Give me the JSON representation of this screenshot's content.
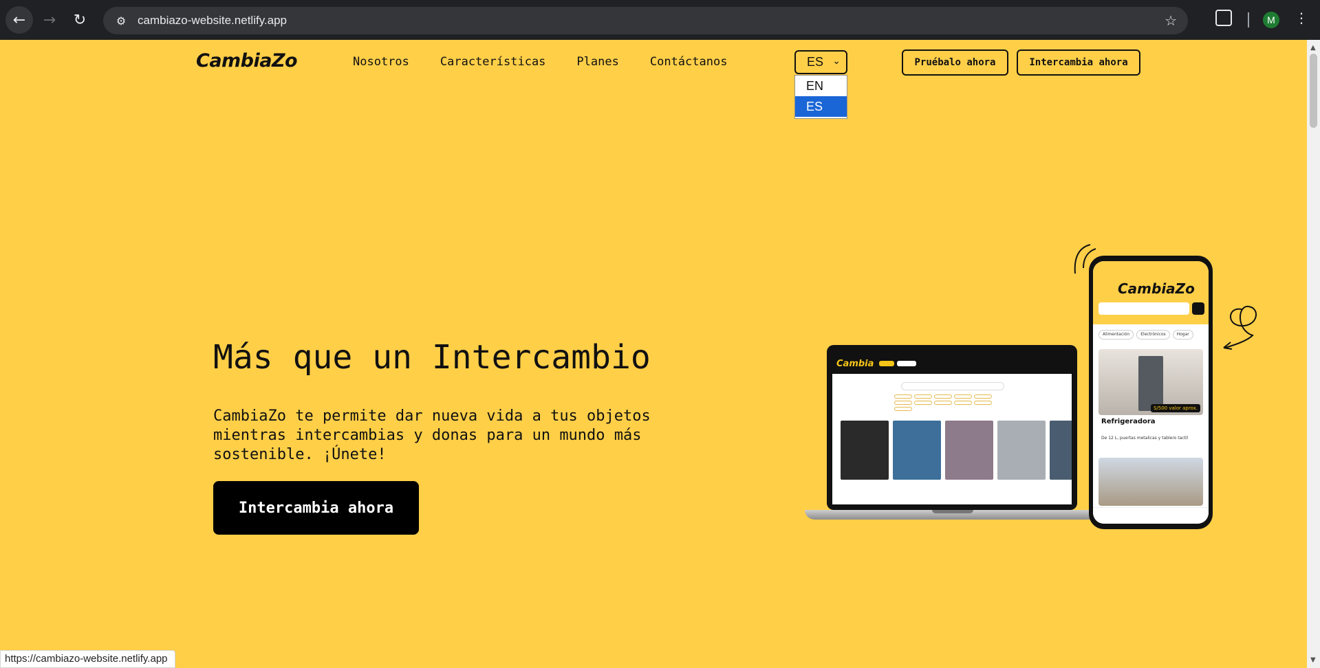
{
  "browser": {
    "url": "cambiazo-website.netlify.app",
    "profile_initial": "M",
    "status_url": "https://cambiazo-website.netlify.app"
  },
  "site": {
    "logo_text": "CambiaZo",
    "nav": [
      "Nosotros",
      "Características",
      "Planes",
      "Contáctanos"
    ],
    "language": {
      "selected": "ES",
      "options": [
        "EN",
        "ES"
      ]
    },
    "buttons": {
      "try_now": "Pruébalo ahora",
      "swap_now": "Intercambia ahora"
    }
  },
  "hero": {
    "title": "Más que un Intercambio",
    "description": "CambiaZo te permite dar nueva vida a tus objetos mientras intercambias y donas para un mundo más sostenible. ¡Únete!",
    "cta": "Intercambia ahora"
  },
  "mockups": {
    "laptop_logo": "Cambia",
    "phone_logo": "CambiaZo",
    "phone_chips": [
      "Alimentación",
      "Electrónicos",
      "Hogar"
    ],
    "phone_price_badge": "S/500 valor aprox.",
    "phone_item_title": "Refrigeradora",
    "phone_item_desc": "De 12 L, puertas metalicas y tablero tactil",
    "laptop_card_colors": [
      "#2a2a2a",
      "#3d6f9a",
      "#8d7a8a",
      "#a8aeb4",
      "#4a5d70"
    ]
  }
}
